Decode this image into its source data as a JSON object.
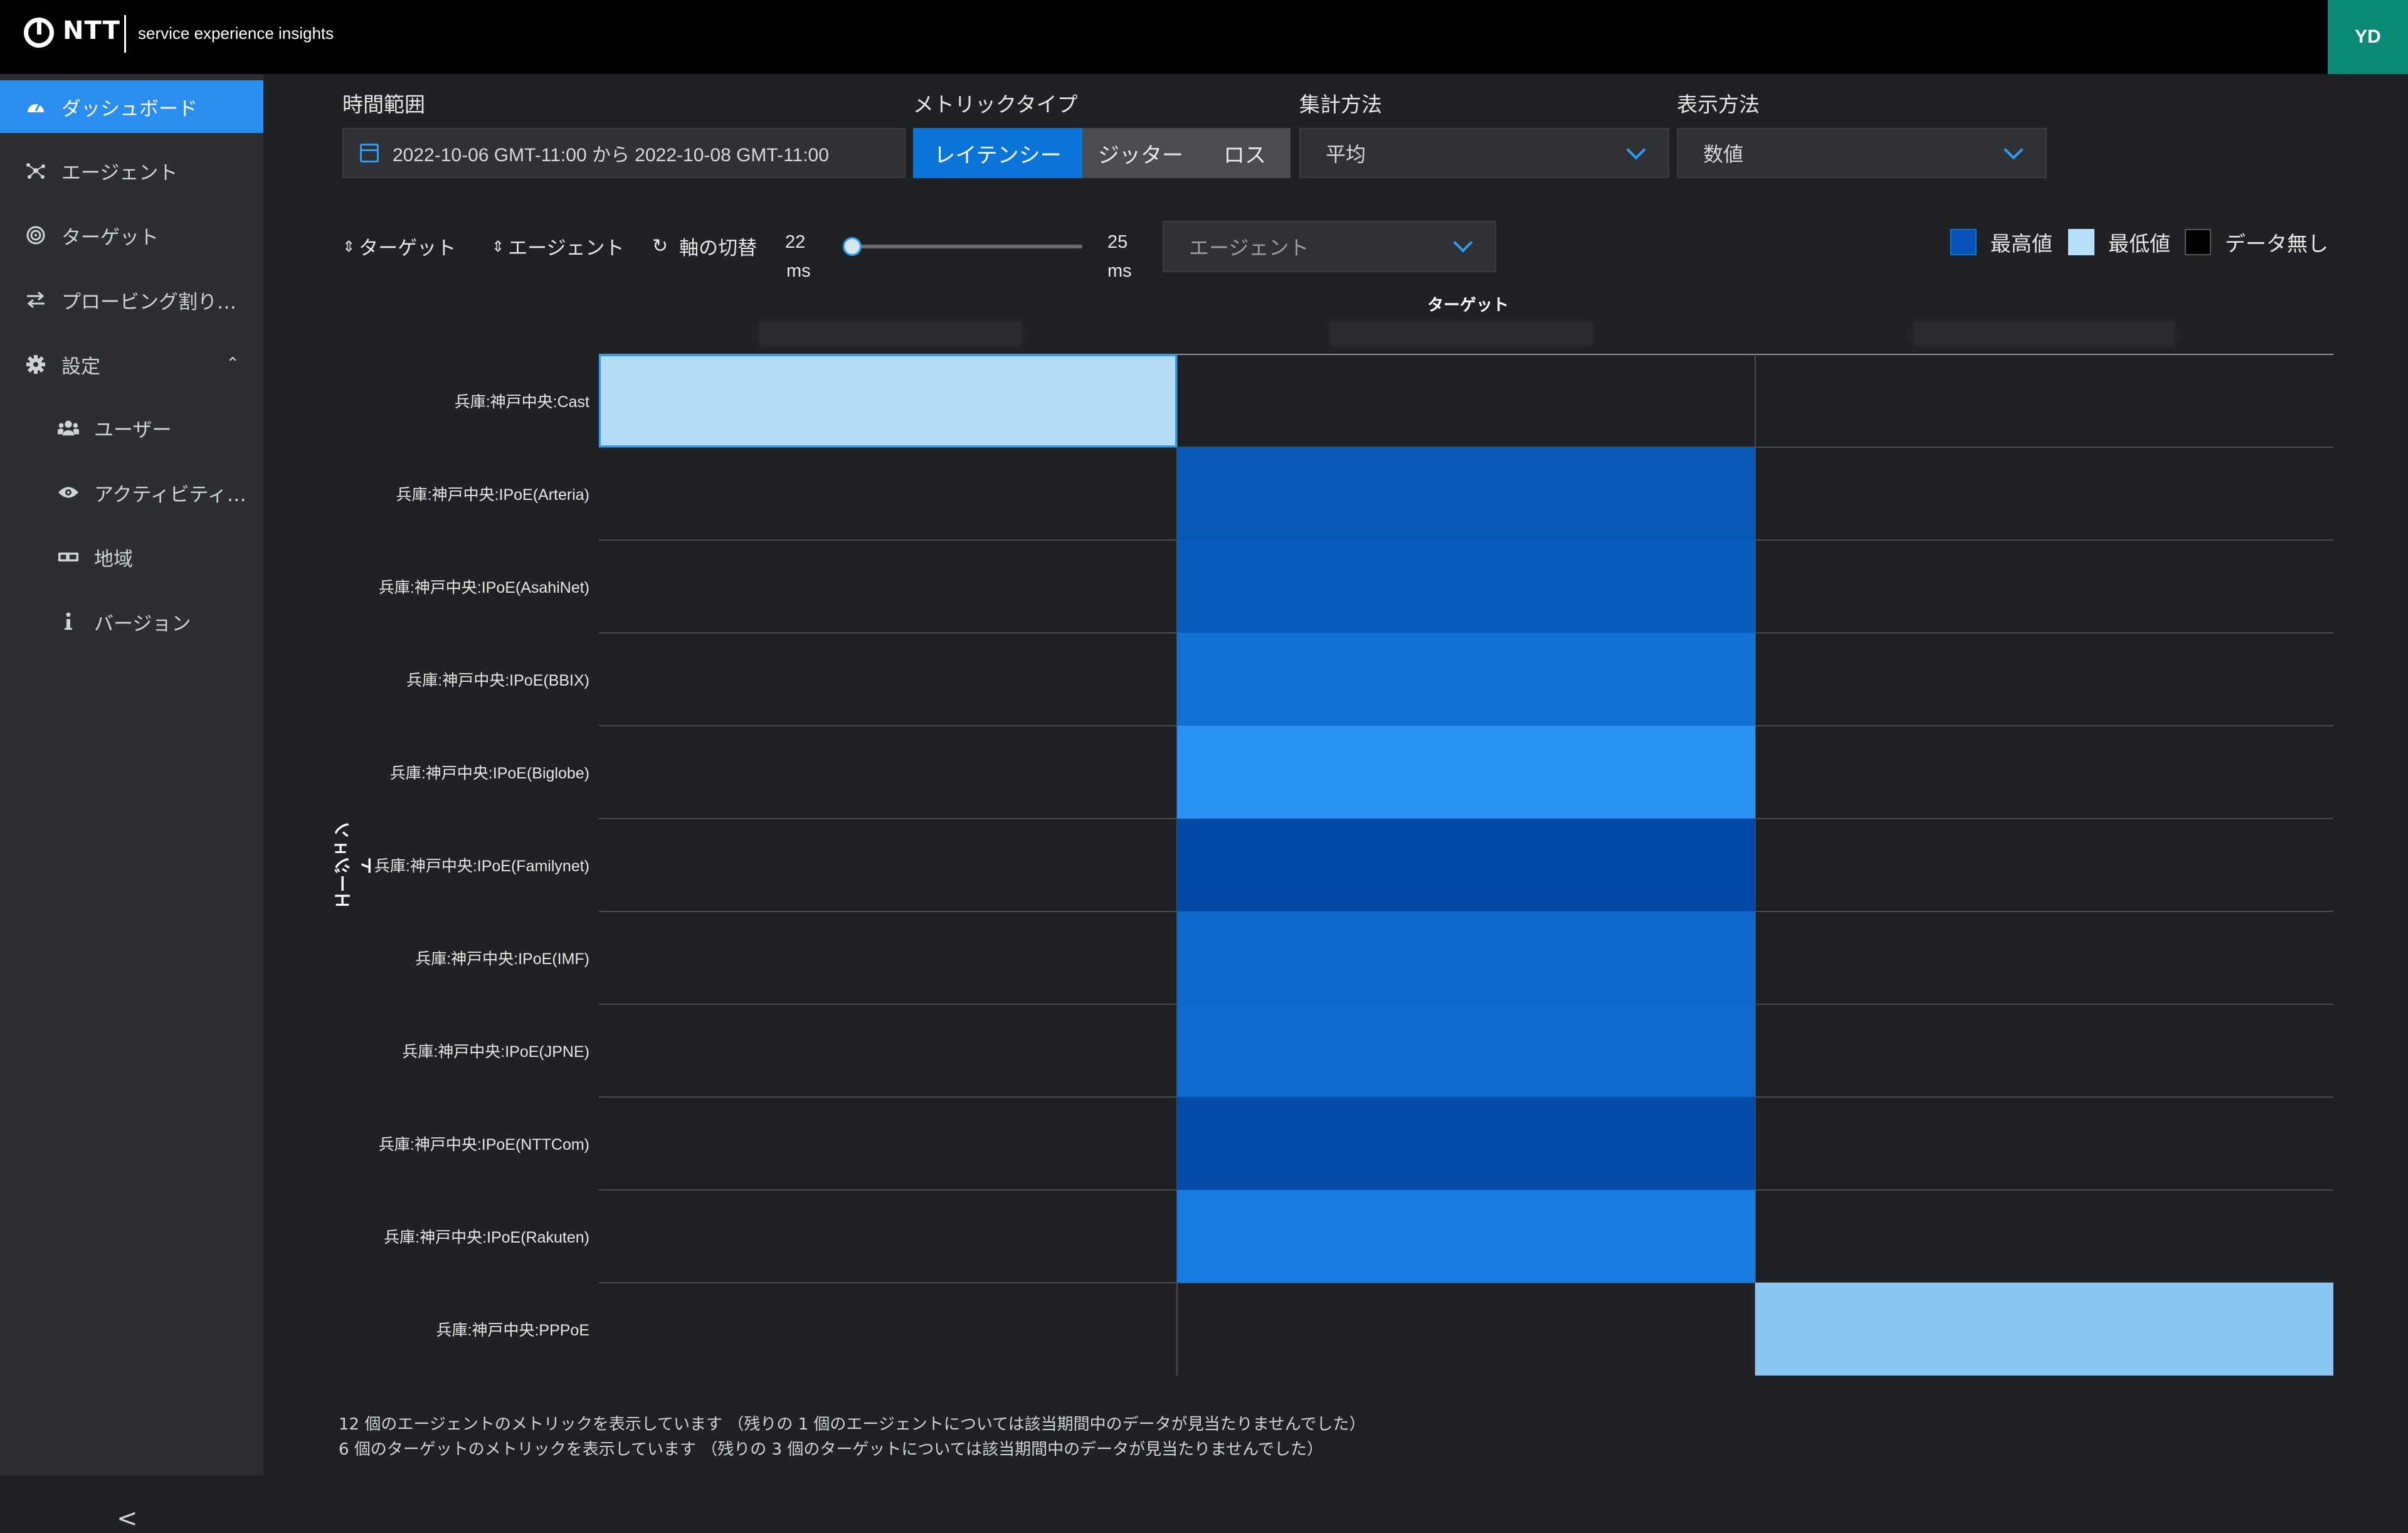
{
  "header": {
    "logo": "NTT",
    "subtitle": "service experience insights",
    "avatar": "YD"
  },
  "sidebar": {
    "items": [
      {
        "label": "ダッシュボード",
        "icon": "gauge-icon"
      },
      {
        "label": "エージェント",
        "icon": "nodes-icon"
      },
      {
        "label": "ターゲット",
        "icon": "target-icon"
      },
      {
        "label": "プロービング割り…",
        "icon": "swap-icon"
      },
      {
        "label": "設定",
        "icon": "gear-icon"
      },
      {
        "label": "ユーザー",
        "icon": "users-icon"
      },
      {
        "label": "アクティビティ…",
        "icon": "eye-icon"
      },
      {
        "label": "地域",
        "icon": "region-icon"
      },
      {
        "label": "バージョン",
        "icon": "info-icon"
      }
    ],
    "collapse": "<"
  },
  "filters": {
    "time_label": "時間範囲",
    "time_value": "2022-10-06 GMT-11:00 から 2022-10-08 GMT-11:00",
    "metric_label": "メトリックタイプ",
    "metric_options": [
      "レイテンシー",
      "ジッター",
      "ロス"
    ],
    "metric_selected": "レイテンシー",
    "agg_label": "集計方法",
    "agg_value": "平均",
    "display_label": "表示方法",
    "display_value": "数値"
  },
  "toolbar": {
    "sort_target": "ターゲット",
    "sort_agent": "エージェント",
    "swap_axis": "軸の切替",
    "range_min": "22",
    "range_max": "25",
    "range_unit": "ms",
    "agent_placeholder": "エージェント",
    "legend": {
      "high": "最高値",
      "low": "最低値",
      "none": "データ無し"
    },
    "colors": {
      "high": "#0652b8",
      "low": "#b8e0fa",
      "none": "#000000"
    }
  },
  "chart_data": {
    "type": "heatmap",
    "xlabel": "ターゲット",
    "ylabel": "エージェント",
    "columns": [
      "",
      "",
      ""
    ],
    "rows": [
      "兵庫:神戸中央:Cast",
      "兵庫:神戸中央:IPoE(Arteria)",
      "兵庫:神戸中央:IPoE(AsahiNet)",
      "兵庫:神戸中央:IPoE(BBIX)",
      "兵庫:神戸中央:IPoE(Biglobe)",
      "兵庫:神戸中央:IPoE(Familynet)",
      "兵庫:神戸中央:IPoE(IMF)",
      "兵庫:神戸中央:IPoE(JPNE)",
      "兵庫:神戸中央:IPoE(NTTCom)",
      "兵庫:神戸中央:IPoE(Rakuten)",
      "兵庫:神戸中央:PPPoE"
    ],
    "cells": [
      [
        {
          "color": "#b4dcf6",
          "selected": true
        },
        null,
        null
      ],
      [
        null,
        {
          "color": "#0758b6"
        },
        null
      ],
      [
        null,
        {
          "color": "#085cbc"
        },
        null
      ],
      [
        null,
        {
          "color": "#1272d4"
        },
        null
      ],
      [
        null,
        {
          "color": "#2a92f2"
        },
        null
      ],
      [
        null,
        {
          "color": "#0449a6"
        },
        null
      ],
      [
        null,
        {
          "color": "#0d68ca"
        },
        null
      ],
      [
        null,
        {
          "color": "#0d69cb"
        },
        null
      ],
      [
        null,
        {
          "color": "#054ca9"
        },
        null
      ],
      [
        null,
        {
          "color": "#167ce2"
        },
        null
      ],
      [
        null,
        null,
        {
          "color": "#8ac6f2"
        }
      ]
    ]
  },
  "footer": {
    "line1": "12 個のエージェントのメトリックを表示しています （残りの 1 個のエージェントについては該当期間中のデータが見当たりませんでした）",
    "line2": "6 個のターゲットのメトリックを表示しています （残りの 3 個のターゲットについては該当期間中のデータが見当たりませんでした）"
  }
}
